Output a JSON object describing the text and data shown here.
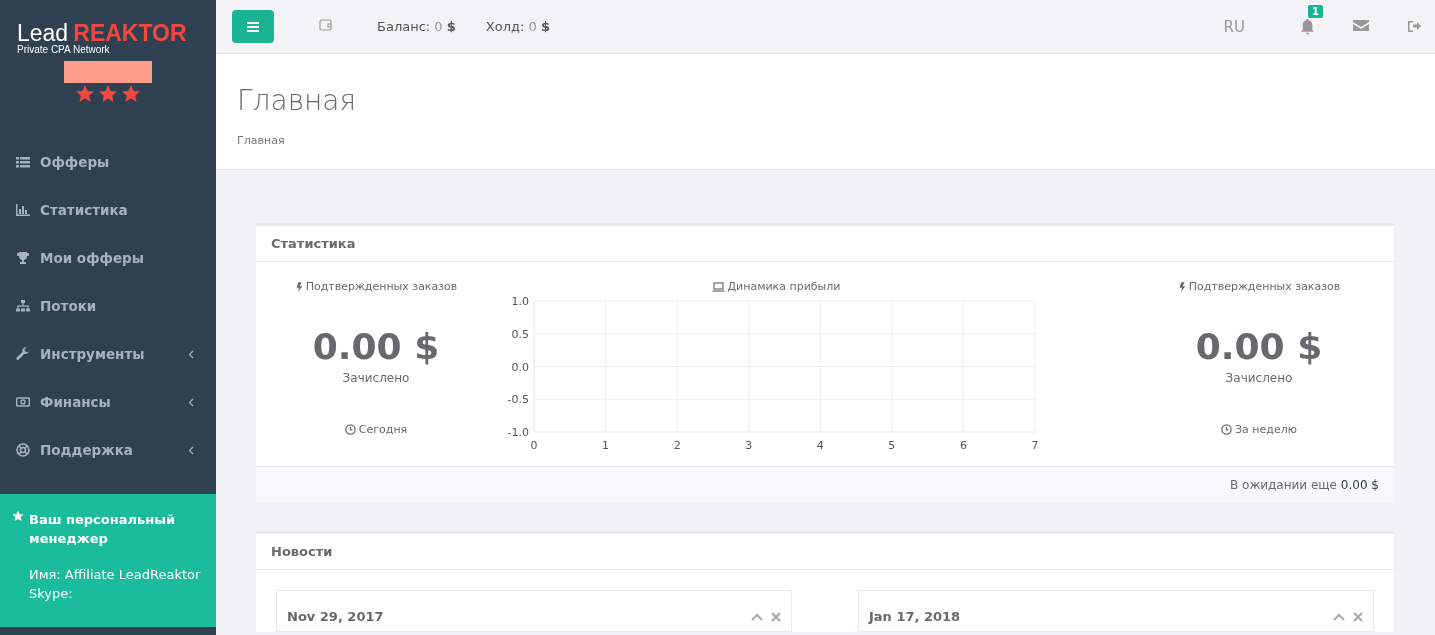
{
  "logo": {
    "word_1": "Lead",
    "word_2": "REAKTOR",
    "tagline": "Private CPA Network"
  },
  "user": {
    "stars": 3
  },
  "sidebar": {
    "items": [
      {
        "label": "Офферы",
        "kind": "link"
      },
      {
        "label": "Статистика",
        "kind": "link"
      },
      {
        "label": "Мои офферы",
        "kind": "link"
      },
      {
        "label": "Потоки",
        "kind": "link"
      },
      {
        "label": "Инструменты",
        "kind": "submenu"
      },
      {
        "label": "Финансы",
        "kind": "submenu"
      },
      {
        "label": "Поддержка",
        "kind": "submenu"
      }
    ],
    "manager": {
      "title": "Ваш персональный менеджер",
      "name": "Имя: Affiliate LeadReaktor",
      "skype": "Skype:"
    }
  },
  "topbar": {
    "balance_label": "Баланс:",
    "balance_value": "0",
    "balance_currency": "$",
    "hold_label": "Холд:",
    "hold_value": "0",
    "hold_currency": "$",
    "language": "RU",
    "notifications": "1"
  },
  "page": {
    "title": "Главная",
    "breadcrumb": "Главная"
  },
  "stats": {
    "title": "Статистика",
    "left": {
      "caption": "Подтвержденных заказов",
      "amount": "0.00 $",
      "label": "Зачислено",
      "period": "Сегодня"
    },
    "chart": {
      "caption": "Динамика прибыли",
      "chart_data": {
        "type": "line",
        "grid": true,
        "xlim": [
          0,
          7
        ],
        "ylim": [
          -1,
          1
        ],
        "xticks": [
          0,
          1,
          2,
          3,
          4,
          5,
          6,
          7
        ],
        "yticks": [
          {
            "value": 1,
            "label": "1.0"
          },
          {
            "value": 0.5,
            "label": "0.5"
          },
          {
            "value": 0,
            "label": "0.0"
          },
          {
            "value": -0.5,
            "label": "-0.5"
          },
          {
            "value": -1,
            "label": "-1.0"
          }
        ]
      }
    },
    "right": {
      "caption": "Подтвержденных заказов",
      "amount": "0.00 $",
      "label": "Зачислено",
      "period": "За неделю"
    },
    "footer_label": "В ожидании еще",
    "footer_value": "0.00 $"
  },
  "news": {
    "title": "Новости",
    "items": [
      {
        "date": "Nov 29, 2017"
      },
      {
        "date": "Jan 17, 2018"
      }
    ]
  }
}
